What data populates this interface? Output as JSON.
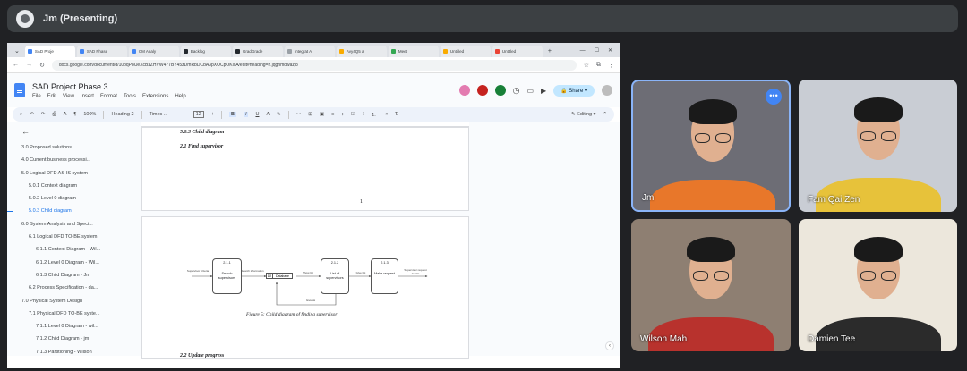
{
  "meeting": {
    "presenter_label": "Jm (Presenting)"
  },
  "browser": {
    "tabs": [
      {
        "label": "SAD Proje",
        "color": "#4285f4",
        "active": true
      },
      {
        "label": "SAD Phase",
        "color": "#4285f4"
      },
      {
        "label": "CM Analy",
        "color": "#4285f4"
      },
      {
        "label": "Backlog",
        "color": "#24292e"
      },
      {
        "label": "GradGrade",
        "color": "#24292e"
      },
      {
        "label": "Integrat A",
        "color": "#9aa0a6"
      },
      {
        "label": "Avy4Q5 a",
        "color": "#f9ab00"
      },
      {
        "label": "Meet",
        "color": "#34a853"
      },
      {
        "label": "Untitled",
        "color": "#f9ab00"
      },
      {
        "label": "Untitled",
        "color": "#ea4335"
      }
    ],
    "url": "docs.google.com/document/d/10oqP8UeXcBzZHVW477BY45zDmRbDCbA3pXOCpOKlxA/edit#heading=h.jqgnmdwazj8"
  },
  "doc": {
    "title": "SAD Project Phase 3",
    "menu": [
      "File",
      "Edit",
      "View",
      "Insert",
      "Format",
      "Tools",
      "Extensions",
      "Help"
    ],
    "share_label": "Share",
    "toolbar": {
      "zoom": "100%",
      "style": "Heading 2",
      "font": "Times ...",
      "font_size": "12",
      "mode": "Editing"
    },
    "outline": [
      {
        "label": "3.0 Proposed solutions",
        "level": 1
      },
      {
        "label": "4.0 Current business processi...",
        "level": 1
      },
      {
        "label": "5.0 Logical DFD AS-IS system",
        "level": 1
      },
      {
        "label": "5.0.1 Context diagram",
        "level": 2
      },
      {
        "label": "5.0.2 Level 0 diagram",
        "level": 2
      },
      {
        "label": "5.0.3 Child diagram",
        "level": 2,
        "active": true
      },
      {
        "label": "6.0 System Analysis and Speci...",
        "level": 1
      },
      {
        "label": "6.1 Logical DFD TO-BE system",
        "level": 2
      },
      {
        "label": "6.1.1 Context Diagram - Wil...",
        "level": 3
      },
      {
        "label": "6.1.2 Level 0 Diagram - Wil...",
        "level": 3
      },
      {
        "label": "6.1.3 Child Diagram - Jm",
        "level": 3
      },
      {
        "label": "6.2 Process Specification - da...",
        "level": 2
      },
      {
        "label": "7.0 Physical System Design",
        "level": 1
      },
      {
        "label": "7.1 Physical DFD TO-BE syste...",
        "level": 2
      },
      {
        "label": "7.1.1 Level 0 Diagram - wil...",
        "level": 3
      },
      {
        "label": "7.1.2 Child Diagram - jm",
        "level": 3
      },
      {
        "label": "7.1.3 Partitioning - Wilson",
        "level": 3
      }
    ],
    "page1": {
      "heading": "5.0.3 Child diagram",
      "subheading": "2.1 Find supervisor",
      "page_number": "1"
    },
    "page2": {
      "figure_caption": "Figure 5: Child diagram of finding supervisor",
      "bottom_heading": "2.2 Update progress"
    },
    "dfd": {
      "processes": [
        {
          "id": "2.1.1",
          "name": "Search supervisors"
        },
        {
          "id": "2.1.2",
          "name": "List of supervisors"
        },
        {
          "id": "2.1.3",
          "name": "Make request"
        }
      ],
      "store": {
        "id": "D2",
        "name": "Database"
      },
      "flows": [
        "Supervisor criteria",
        "Search information",
        "Show list",
        "Give list",
        "Supervisor request details",
        "Give ok"
      ]
    }
  },
  "participants": [
    {
      "name": "Jm",
      "shirt": "#e8772a",
      "bg": "#6d6d75",
      "pinned": true
    },
    {
      "name": "Fam Qai Zen",
      "shirt": "#e7c23a",
      "bg": "#c9cdd4"
    },
    {
      "name": "Wilson Mah",
      "shirt": "#b8322d",
      "bg": "#8e7f72"
    },
    {
      "name": "Damien Tee",
      "shirt": "#2b2b2b",
      "bg": "#ece7dc"
    }
  ]
}
